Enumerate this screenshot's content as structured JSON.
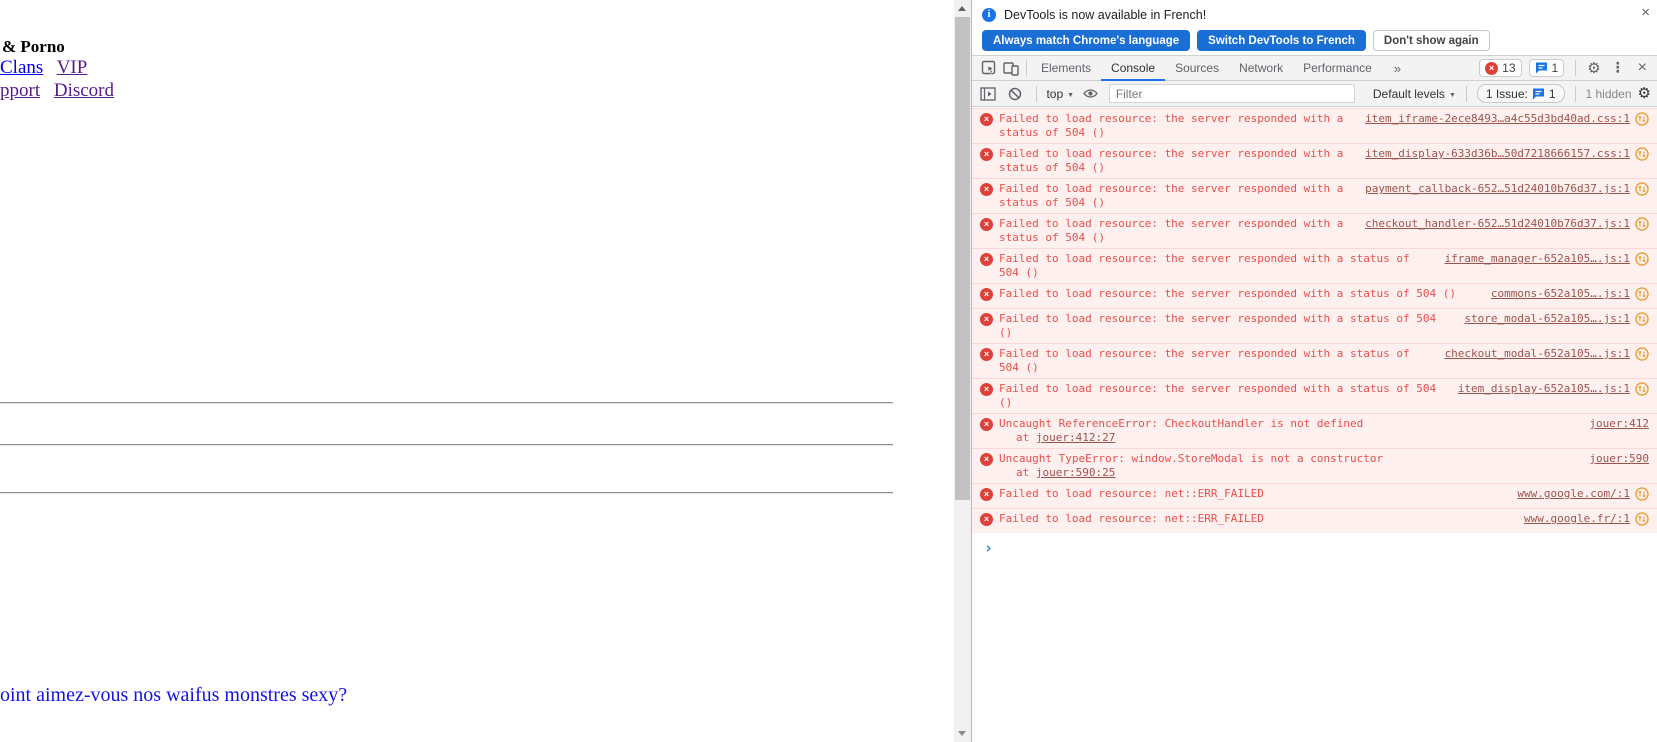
{
  "page": {
    "title_fragment": "& Porno",
    "links_row1": [
      {
        "label": "Clans",
        "color": "#0000EE"
      },
      {
        "label": "VIP",
        "color": "#551A8B"
      }
    ],
    "links_row2": [
      {
        "label": "pport",
        "color": "#551A8B"
      },
      {
        "label": "Discord",
        "color": "#551A8B"
      }
    ],
    "question": "oint aimez-vous nos waifus monstres sexy?"
  },
  "devtools": {
    "banner": {
      "message": "DevTools is now available in French!",
      "buttons": [
        {
          "label": "Always match Chrome's language",
          "style": "primary"
        },
        {
          "label": "Switch DevTools to French",
          "style": "primary"
        },
        {
          "label": "Don't show again",
          "style": "secondary"
        }
      ],
      "close_label": "×"
    },
    "tabs": {
      "items": [
        "Elements",
        "Console",
        "Sources",
        "Network",
        "Performance"
      ],
      "selected": "Console",
      "more_symbol": "»",
      "error_count": "13",
      "issue_count": "1",
      "close_label": "×"
    },
    "toolbar": {
      "context_selector": "top",
      "filter_placeholder": "Filter",
      "levels_label": "Default levels",
      "issues_label": "1 Issue:",
      "issues_count": "1",
      "hidden_label": "1 hidden"
    },
    "console": {
      "prompt_symbol": "›",
      "messages": [
        {
          "line1": "Failed to load resource: the server responded with a",
          "line2": "status of 504 ()",
          "source": "item_iframe-2ece8493…a4c55d3bd40ad.css:1",
          "extension_icon": true
        },
        {
          "line1": "Failed to load resource: the server responded with a",
          "line2": "status of 504 ()",
          "source": "item_display-633d36b…50d7218666157.css:1",
          "extension_icon": true
        },
        {
          "line1": "Failed to load resource: the server responded with a",
          "line2": "status of 504 ()",
          "source": "payment_callback-652…51d24010b76d37.js:1",
          "extension_icon": true
        },
        {
          "line1": "Failed to load resource: the server responded with a",
          "line2": "status of 504 ()",
          "source": "checkout_handler-652…51d24010b76d37.js:1",
          "extension_icon": true
        },
        {
          "line1": "Failed to load resource: the server responded with a status of",
          "line2": "504 ()",
          "source": "iframe_manager-652a105….js:1",
          "extension_icon": true
        },
        {
          "line1": "Failed to load resource: the server responded with a status of 504 ()",
          "line2": "",
          "source": "commons-652a105….js:1",
          "extension_icon": true
        },
        {
          "line1": "Failed to load resource: the server responded with a status of 504",
          "line2": "()",
          "source": "store_modal-652a105….js:1",
          "extension_icon": true
        },
        {
          "line1": "Failed to load resource: the server responded with a status of",
          "line2": "504 ()",
          "source": "checkout_modal-652a105….js:1",
          "extension_icon": true
        },
        {
          "line1": "Failed to load resource: the server responded with a status of 504",
          "line2": "()",
          "source": "item_display-652a105….js:1",
          "extension_icon": true
        },
        {
          "line1": "Uncaught ReferenceError: CheckoutHandler is not defined",
          "stack_prefix": "at",
          "stack_link": "jouer:412:27",
          "source": "jouer:412",
          "extension_icon": false
        },
        {
          "line1": "Uncaught TypeError: window.StoreModal is not a constructor",
          "stack_prefix": "at",
          "stack_link": "jouer:590:25",
          "source": "jouer:590",
          "extension_icon": false
        },
        {
          "line1": "Failed to load resource: net::ERR_FAILED",
          "line2": "",
          "source": "www.google.com/:1",
          "extension_icon": true
        },
        {
          "line1": "Failed to load resource: net::ERR_FAILED",
          "line2": "",
          "source": "www.google.fr/:1",
          "extension_icon": true
        }
      ]
    },
    "colors": {
      "accent_blue": "#1a73e8",
      "button_blue": "#1a6fd4",
      "error_red_text": "#e5514a",
      "error_icon_red": "#dc4238",
      "error_row_bg": "#fff0f0",
      "error_row_border": "#fbd7d7",
      "source_link_red": "#9a544c",
      "extension_icon_orange": "#e8a33d",
      "link_blue": "#0000EE",
      "link_visited_purple": "#551A8B",
      "question_blue": "#1414dd"
    }
  }
}
